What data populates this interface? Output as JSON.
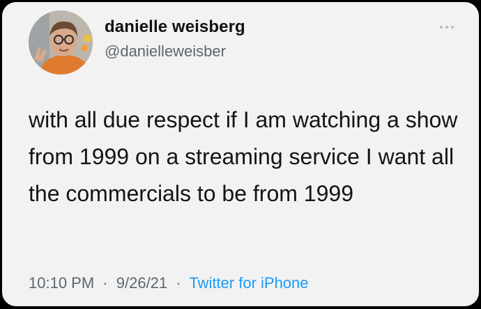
{
  "tweet": {
    "author": {
      "display_name": "danielle weisberg",
      "handle": "@danielleweisber",
      "avatar_icon": "profile-photo"
    },
    "text": "with all due respect if I am watching a show from 1999 on a streaming service I want all the commercials to be from 1999",
    "time": "10:10 PM",
    "date": "9/26/21",
    "separator": "·",
    "source": "Twitter for iPhone",
    "more_icon": "more-horizontal-icon"
  },
  "colors": {
    "card_background": "#f2f2f2",
    "frame_background": "#000000",
    "text_primary": "#141414",
    "text_secondary": "#5b6670",
    "link": "#1d9bf0"
  }
}
